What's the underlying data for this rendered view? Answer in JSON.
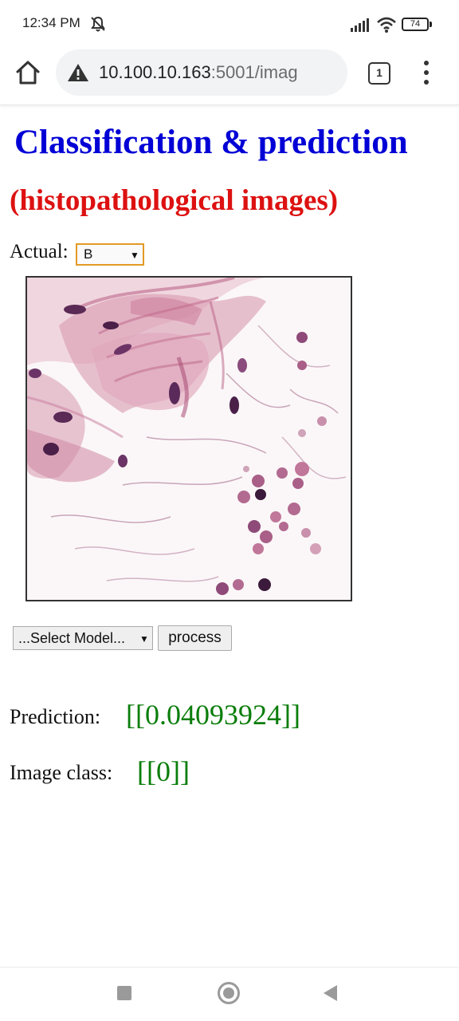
{
  "status_bar": {
    "time": "12:34 PM",
    "battery": "74",
    "icons": [
      "mute-icon",
      "signal-icon",
      "wifi-icon",
      "battery-icon"
    ]
  },
  "browser": {
    "url_host": "10.100.10.163",
    "url_rest": ":5001/imag",
    "tab_count": "1",
    "icons": [
      "home-icon",
      "warning-icon",
      "tabs-icon",
      "menu-icon"
    ]
  },
  "page": {
    "title": "Classification & prediction",
    "subtitle": "(histopathological images)",
    "actual_label": "Actual:",
    "actual_selected": "B",
    "model_selected": "...Select Model...",
    "process_label": "process",
    "prediction_label": "Prediction:",
    "prediction_value": "[[0.04093924]]",
    "class_label": "Image class:",
    "class_value": "[[0]]",
    "colors": {
      "title": "#0000d6",
      "subtitle": "#dd1111",
      "result": "#0a7d0a",
      "select_border": "#e39a25"
    }
  },
  "nav_bar": {
    "icons": [
      "recent-apps-icon",
      "home-circle-icon",
      "back-icon"
    ]
  }
}
